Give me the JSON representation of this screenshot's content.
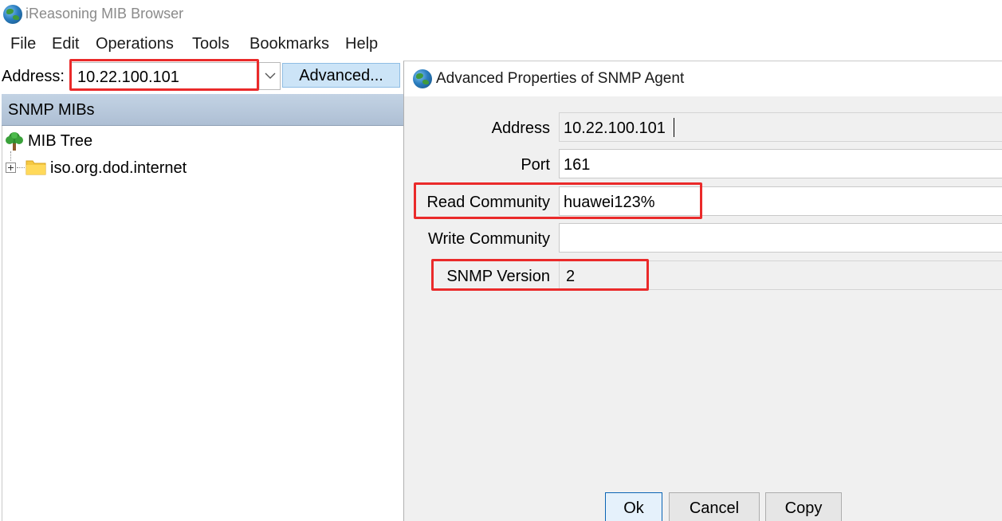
{
  "window": {
    "title": "iReasoning MIB Browser",
    "icon": "globe-icon"
  },
  "menu": [
    "File",
    "Edit",
    "Operations",
    "Tools",
    "Bookmarks",
    "Help"
  ],
  "toolbar": {
    "address_label": "Address:",
    "address_value": "10.22.100.101",
    "advanced_label": "Advanced..."
  },
  "mib_panel": {
    "header": "SNMP MIBs",
    "root": "MIB Tree",
    "nodes": [
      "iso.org.dod.internet"
    ]
  },
  "dialog": {
    "title": "Advanced Properties of SNMP Agent",
    "fields": {
      "address": {
        "label": "Address",
        "value": "10.22.100.101"
      },
      "port": {
        "label": "Port",
        "value": "161"
      },
      "read_community": {
        "label": "Read Community",
        "value": "huawei123%"
      },
      "write_community": {
        "label": "Write Community",
        "value": ""
      },
      "snmp_version": {
        "label": "SNMP Version",
        "value": "2"
      }
    },
    "buttons": {
      "ok": "Ok",
      "cancel": "Cancel",
      "copy": "Copy"
    }
  },
  "highlight_color": "#ea2a2a"
}
